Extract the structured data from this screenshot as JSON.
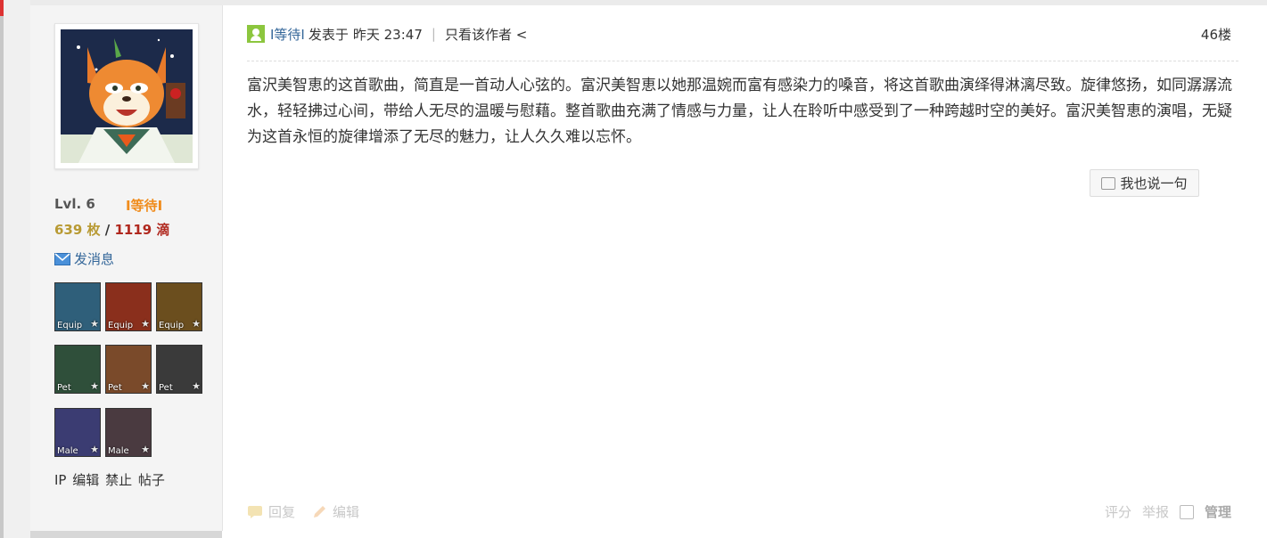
{
  "sidebar": {
    "level": "Lvl. 6",
    "rank": "Ι等待Ι",
    "coins": "639 枚",
    "separator": "/",
    "drops": "1119 滴",
    "send_message": "发消息",
    "medals": [
      {
        "tag": "Equip",
        "color": "#2f5f7a"
      },
      {
        "tag": "Equip",
        "color": "#8a2f1c"
      },
      {
        "tag": "Equip",
        "color": "#6b4e1e"
      },
      {
        "tag": "Pet",
        "color": "#2f4f3a"
      },
      {
        "tag": "Pet",
        "color": "#7a4a2a"
      },
      {
        "tag": "Pet",
        "color": "#3a3a3a"
      },
      {
        "tag": "Male",
        "color": "#3b3c72"
      },
      {
        "tag": "Male",
        "color": "#4a3a40"
      }
    ],
    "admin_links": {
      "ip": "IP",
      "edit": "编辑",
      "ban": "禁止",
      "posts": "帖子"
    }
  },
  "post": {
    "username": "Ι等待Ι",
    "posted_label": "发表于",
    "time": "昨天 23:47",
    "author_only": "只看该作者 <",
    "floor": "46楼",
    "body": "富沢美智恵的这首歌曲，简直是一首动人心弦的。富沢美智恵以她那温婉而富有感染力的嗓音，将这首歌曲演绎得淋漓尽致。旋律悠扬，如同潺潺流水，轻轻拂过心间，带给人无尽的温暖与慰藉。整首歌曲充满了情感与力量，让人在聆听中感受到了一种跨越时空的美好。富沢美智恵的演唱，无疑为这首永恒的旋律增添了无尽的魅力，让人久久难以忘怀。",
    "reply_button": "我也说一句"
  },
  "footer": {
    "reply": "回复",
    "edit": "编辑",
    "rate": "评分",
    "report": "举报",
    "manage": "管理"
  },
  "colors": {
    "link": "#336699",
    "rank": "#f08c1c",
    "coins": "#b89a33",
    "drops": "#b0281e",
    "user_icon": "#8cc63e"
  }
}
